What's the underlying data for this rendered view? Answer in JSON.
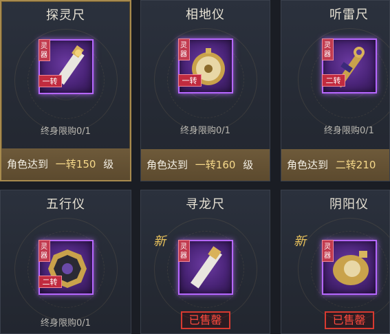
{
  "items": [
    {
      "name": "探灵尺",
      "tag": "灵器",
      "tier": "一转",
      "limit": "终身限购0/1",
      "req_prefix": "角色达到",
      "req_tier": "一转150",
      "req_suffix": "级",
      "selected": true,
      "new": false,
      "sold": false
    },
    {
      "name": "相地仪",
      "tag": "灵器",
      "tier": "一转",
      "limit": "终身限购0/1",
      "req_prefix": "角色达到",
      "req_tier": "一转160",
      "req_suffix": "级",
      "selected": false,
      "new": false,
      "sold": false
    },
    {
      "name": "听雷尺",
      "tag": "灵器",
      "tier": "二转",
      "limit": "终身限购0/1",
      "req_prefix": "角色达到",
      "req_tier": "二转210",
      "req_suffix": "",
      "selected": false,
      "new": false,
      "sold": false
    },
    {
      "name": "五行仪",
      "tag": "灵器",
      "tier": "二转",
      "limit": "终身限购0/1",
      "req_prefix": "",
      "req_tier": "",
      "req_suffix": "",
      "selected": false,
      "new": false,
      "sold": false
    },
    {
      "name": "寻龙尺",
      "tag": "灵器",
      "tier": "",
      "limit": "",
      "req_prefix": "",
      "req_tier": "",
      "req_suffix": "",
      "selected": false,
      "new": true,
      "new_label": "新",
      "sold": true,
      "sold_label": "已售罄"
    },
    {
      "name": "阴阳仪",
      "tag": "灵器",
      "tier": "",
      "limit": "",
      "req_prefix": "",
      "req_tier": "",
      "req_suffix": "",
      "selected": false,
      "new": true,
      "new_label": "新",
      "sold": true,
      "sold_label": "已售罄"
    }
  ],
  "colors": {
    "slot_border": "#b667ff",
    "requirement_bar": "#6e5a3a",
    "sold_out": "#ff4a3e",
    "new_badge": "#e9c25c"
  }
}
